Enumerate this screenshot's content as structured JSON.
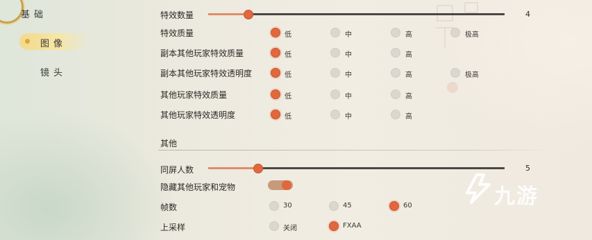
{
  "sidebar": {
    "items": [
      {
        "label": "基础"
      },
      {
        "label": "图像"
      },
      {
        "label": "镜头"
      }
    ]
  },
  "rows": {
    "effect_count": {
      "label": "特效数量",
      "value": "4",
      "level": 0.14
    },
    "effect_quality": {
      "label": "特效质量",
      "options": [
        "低",
        "中",
        "高",
        "极高"
      ],
      "selected": "低"
    },
    "dungeon_player_quality": {
      "label": "副本其他玩家特效质量",
      "options": [
        "低",
        "中",
        "高"
      ],
      "selected": "低"
    },
    "dungeon_player_opacity": {
      "label": "副本其他玩家特效透明度",
      "options": [
        "低",
        "中",
        "高",
        "极高"
      ],
      "selected": "低"
    },
    "player_quality": {
      "label": "其他玩家特效质量",
      "options": [
        "低",
        "中",
        "高"
      ],
      "selected": "低"
    },
    "player_opacity": {
      "label": "其他玩家特效透明度",
      "options": [
        "低",
        "中",
        "高"
      ],
      "selected": "低"
    }
  },
  "other": {
    "section_title": "其他",
    "same_screen": {
      "label": "同屏人数",
      "value": "5",
      "level": 0.16
    },
    "hide_players": {
      "label": "隐藏其他玩家和宠物",
      "on": true
    },
    "fps": {
      "label": "帧数",
      "options": [
        "30",
        "45",
        "60"
      ],
      "selected": "60"
    },
    "upsample": {
      "label": "上采样",
      "options": [
        "关闭",
        "FXAA"
      ],
      "selected": "FXAA"
    }
  },
  "watermark": {
    "text": "九游"
  },
  "colors": {
    "accent": "#e1683e",
    "nav_active": "#f3d98b"
  }
}
